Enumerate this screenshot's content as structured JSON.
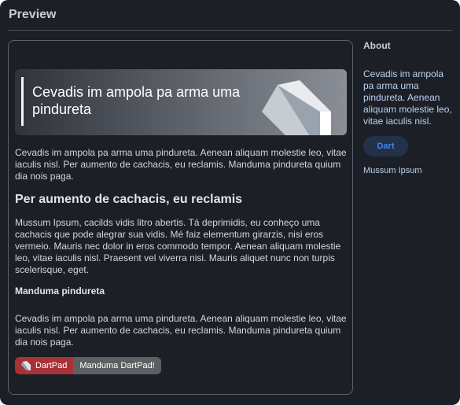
{
  "window": {
    "title": "Preview"
  },
  "hero": {
    "title": "Cevadis im ampola pa arma uma pindureta",
    "logo_icon": "dart-logo-icon"
  },
  "content": {
    "intro": "Cevadis im ampola pa arma uma pindureta. Aenean aliquam molestie leo, vitae iaculis nisl. Per aumento de cachacis, eu reclamis. Manduma pindureta quium dia nois paga.",
    "heading": "Per aumento de cachacis, eu reclamis",
    "paragraph2": "Mussum Ipsum, cacilds vidis litro abertis. Tá deprimidis, eu conheço uma cachacis que pode alegrar sua vidis. Mé faiz elementum girarzis, nisi eros vermeio. Mauris nec dolor in eros commodo tempor. Aenean aliquam molestie leo, vitae iaculis nisl. Praesent vel viverra nisi. Mauris aliquet nunc non turpis scelerisque, eget.",
    "subheading": "Manduma pindureta",
    "paragraph3": "Cevadis im ampola pa arma uma pindureta. Aenean aliquam molestie leo, vitae iaculis nisl. Per aumento de cachacis, eu reclamis. Manduma pindureta quium dia nois paga."
  },
  "badge": {
    "left_label": "DartPad",
    "right_label": "Manduma DartPad!",
    "icon": "dartpad-icon",
    "left_color": "#a83237",
    "right_color": "#5e5f62"
  },
  "sidebar": {
    "title": "About",
    "description": "Cevadis im ampola pa arma uma pindureta. Aenean aliquam molestie leo, vitae iaculis nisl.",
    "chip_label": "Dart",
    "link": "Mussum Ipsum"
  },
  "colors": {
    "background": "#1c1f26",
    "accent": "#3d86e8",
    "link": "#b9d3f2"
  }
}
